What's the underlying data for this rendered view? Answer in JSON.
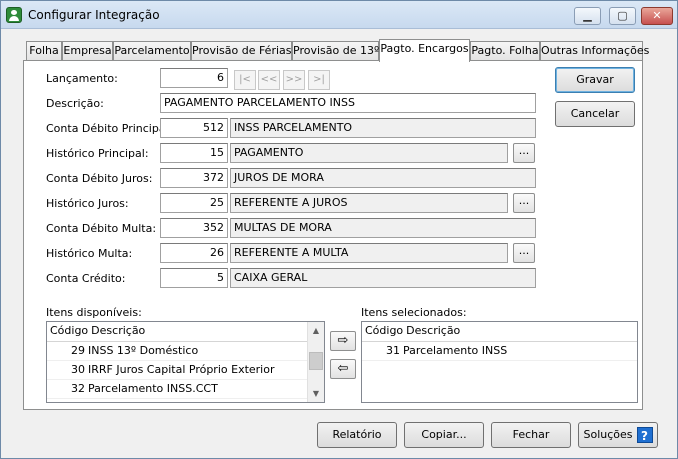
{
  "window": {
    "title": "Configurar Integração"
  },
  "titlebar_buttons": {
    "minimize": "▁",
    "maximize": "▢",
    "close": "✕"
  },
  "tabs": [
    {
      "label": "Folha",
      "active": false
    },
    {
      "label": "Empresa",
      "active": false
    },
    {
      "label": "Parcelamento",
      "active": false
    },
    {
      "label": "Provisão de Férias",
      "active": false
    },
    {
      "label": "Provisão de 13º",
      "active": false
    },
    {
      "label": "Pagto. Encargos",
      "active": true
    },
    {
      "label": "Pagto. Folha",
      "active": false
    },
    {
      "label": "Outras Informações",
      "active": false
    }
  ],
  "form": {
    "lancamento": {
      "label": "Lançamento:",
      "value": "6"
    },
    "nav": {
      "first": "|<",
      "prev": "<<",
      "next": ">>",
      "last": ">|"
    },
    "descricao": {
      "label": "Descrição:",
      "value": "PAGAMENTO PARCELAMENTO INSS"
    },
    "conta_debito_principal": {
      "label": "Conta Débito Principal:",
      "code": "512",
      "desc": "INSS PARCELAMENTO"
    },
    "historico_principal": {
      "label": "Histórico Principal:",
      "code": "15",
      "desc": "PAGAMENTO"
    },
    "conta_debito_juros": {
      "label": "Conta Débito Juros:",
      "code": "372",
      "desc": "JUROS DE MORA"
    },
    "historico_juros": {
      "label": "Histórico Juros:",
      "code": "25",
      "desc": "REFERENTE A JUROS"
    },
    "conta_debito_multa": {
      "label": "Conta Débito Multa:",
      "code": "352",
      "desc": "MULTAS DE MORA"
    },
    "historico_multa": {
      "label": "Histórico Multa:",
      "code": "26",
      "desc": "REFERENTE A MULTA"
    },
    "conta_credito": {
      "label": "Conta Crédito:",
      "code": "5",
      "desc": "CAIXA GERAL"
    },
    "ellipsis": "..."
  },
  "side_buttons": {
    "gravar": "Gravar",
    "cancelar": "Cancelar"
  },
  "available": {
    "label": "Itens disponíveis:",
    "header_code": "Código",
    "header_desc": "Descrição",
    "items": [
      {
        "code": "29",
        "desc": "INSS 13º Doméstico"
      },
      {
        "code": "30",
        "desc": "IRRF Juros Capital Próprio Exterior"
      },
      {
        "code": "32",
        "desc": "Parcelamento INSS.CCT"
      }
    ]
  },
  "selected": {
    "label": "Itens selecionados:",
    "header_code": "Código",
    "header_desc": "Descrição",
    "items": [
      {
        "code": "31",
        "desc": "Parcelamento INSS"
      }
    ]
  },
  "transfer": {
    "add": "⇨",
    "remove": "⇦"
  },
  "footer": {
    "relatorio": "Relatório",
    "copiar": "Copiar...",
    "fechar": "Fechar",
    "solucoes": "Soluções",
    "help": "?"
  }
}
